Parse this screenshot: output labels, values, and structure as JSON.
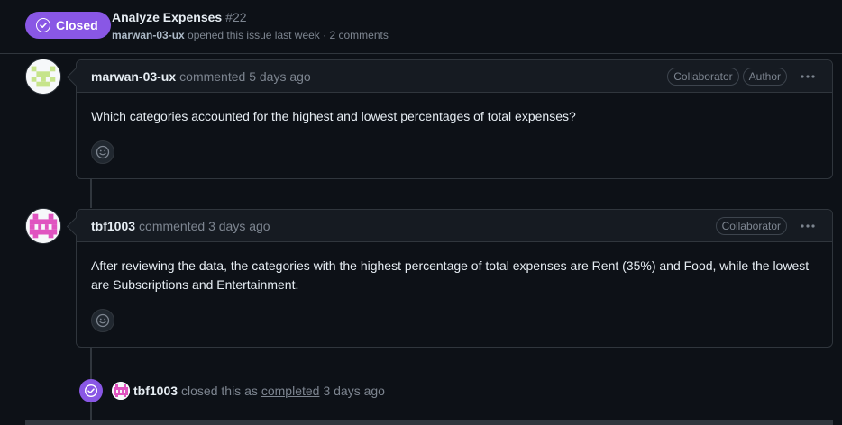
{
  "issue": {
    "state": "Closed",
    "title": "Analyze Expenses",
    "number": "#22",
    "author": "marwan-03-ux",
    "opened_text": "opened this issue last week · 2 comments"
  },
  "comments": [
    {
      "author": "marwan-03-ux",
      "meta": "commented 5 days ago",
      "tags": [
        "Collaborator",
        "Author"
      ],
      "body": "Which categories accounted for the highest and lowest percentages of total expenses?"
    },
    {
      "author": "tbf1003",
      "meta": "commented 3 days ago",
      "tags": [
        "Collaborator"
      ],
      "body": "After reviewing the data, the categories with the highest percentage of total expenses are Rent (35%) and Food, while the lowest are Subscriptions and Entertainment."
    }
  ],
  "event": {
    "actor": "tbf1003",
    "text_before": "closed this as",
    "link": "completed",
    "time": "3 days ago"
  },
  "colors": {
    "closed_purple": "#8957e5",
    "background": "#0d1117",
    "border": "#30363d"
  },
  "icons": {
    "state": "check-circle-icon",
    "more": "kebab-horizontal-icon",
    "reaction": "smiley-icon",
    "event": "check-circle-icon"
  }
}
